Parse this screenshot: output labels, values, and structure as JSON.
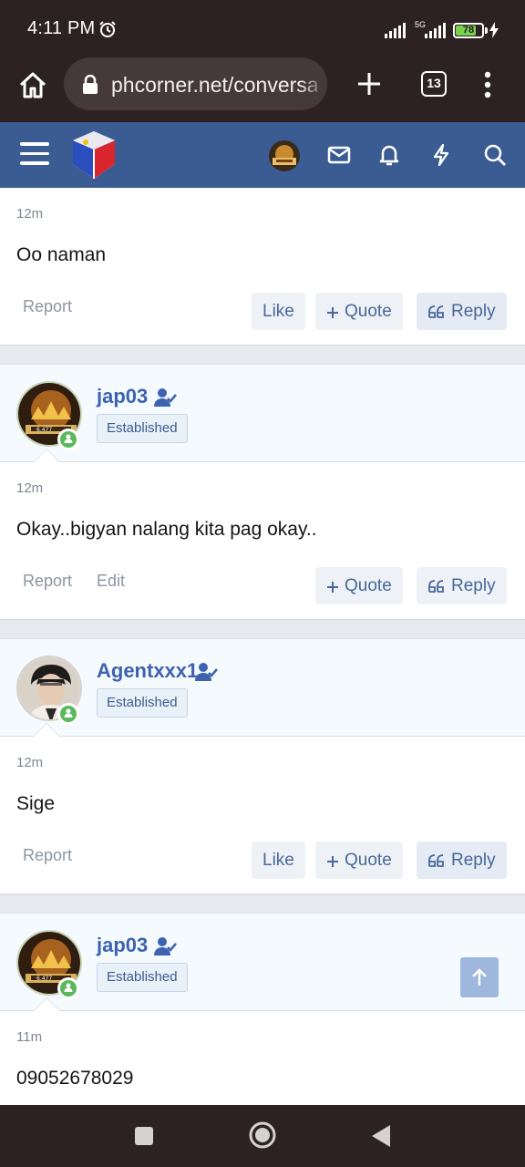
{
  "status_bar": {
    "time": "4:11 PM",
    "network_label": "5G",
    "battery": "78",
    "battery_level": 0.78
  },
  "browser": {
    "url": "phcorner.net/conversations",
    "tab_count": "13"
  },
  "colors": {
    "header_bg": "#3b5c93",
    "username": "#3d63b0",
    "online": "#5cb85c",
    "browser_bg": "#2b2221"
  },
  "posts": [
    {
      "time": "12m",
      "text": "Oo naman",
      "report_label": "Report",
      "like_label": "Like",
      "quote_label": "Quote",
      "reply_label": "Reply"
    },
    {
      "username": "jap03",
      "user_title": "Established",
      "time": "12m",
      "text": "Okay..bigyan nalang kita pag okay..",
      "report_label": "Report",
      "edit_label": "Edit",
      "quote_label": "Quote",
      "reply_label": "Reply"
    },
    {
      "username": "Agentxxx1",
      "user_title": "Established",
      "time": "12m",
      "text": "Sige",
      "report_label": "Report",
      "like_label": "Like",
      "quote_label": "Quote",
      "reply_label": "Reply"
    },
    {
      "username": "jap03",
      "user_title": "Established",
      "time": "11m",
      "text": "09052678029"
    }
  ],
  "icons": {
    "header": [
      "menu-icon",
      "site-logo",
      "avatar",
      "envelope-icon",
      "bell-icon",
      "bolt-icon",
      "search-icon"
    ],
    "nav": [
      "recents-icon",
      "home-icon",
      "back-icon"
    ]
  }
}
